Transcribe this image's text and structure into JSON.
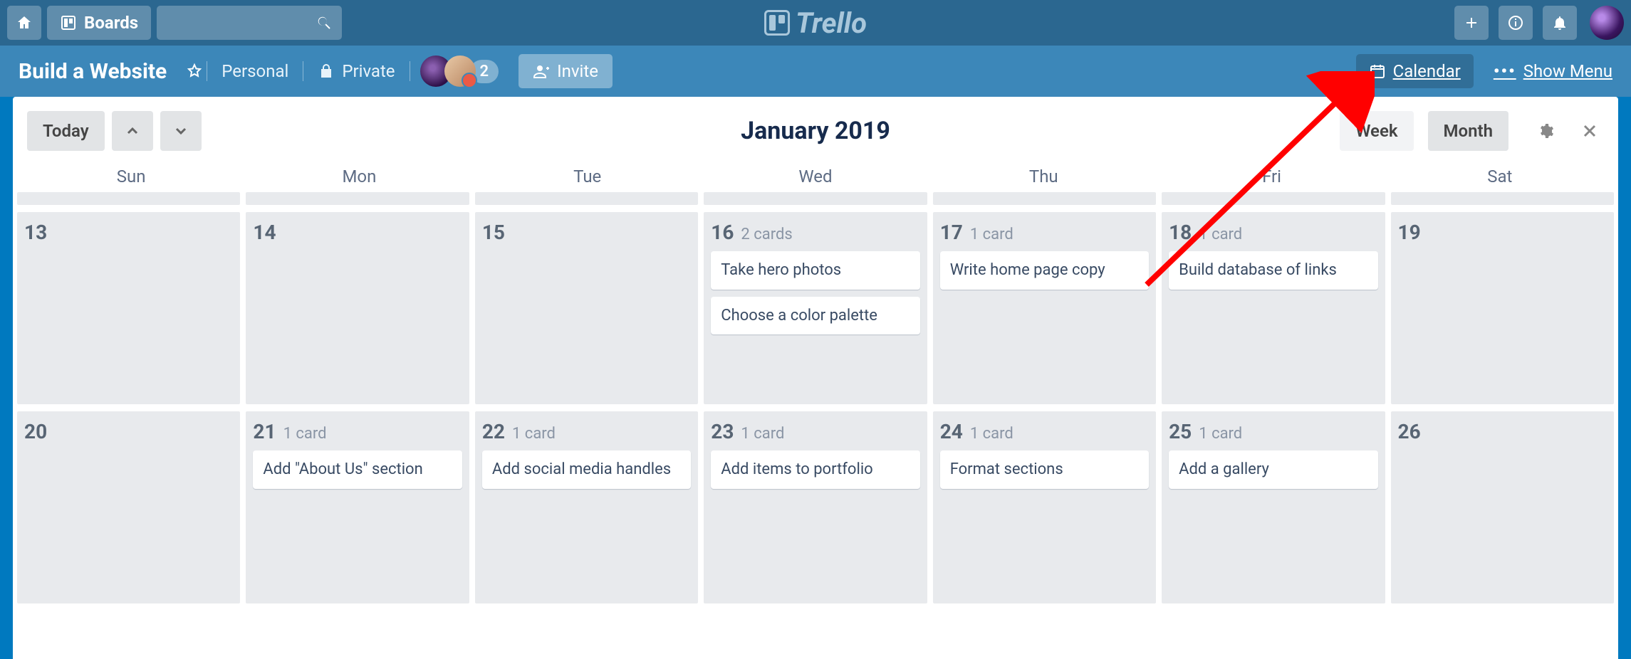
{
  "header": {
    "boards_label": "Boards",
    "logo_text": "Trello"
  },
  "board": {
    "title": "Build a Website",
    "visibility_team": "Personal",
    "visibility_level": "Private",
    "member_count": "2",
    "invite_label": "Invite",
    "calendar_label": "Calendar",
    "show_menu_label": "Show Menu"
  },
  "calendar": {
    "today_label": "Today",
    "title": "January 2019",
    "week_label": "Week",
    "month_label": "Month",
    "weekdays": [
      "Sun",
      "Mon",
      "Tue",
      "Wed",
      "Thu",
      "Fri",
      "Sat"
    ],
    "rows": [
      [
        {
          "day": "13",
          "count": "",
          "cards": []
        },
        {
          "day": "14",
          "count": "",
          "cards": []
        },
        {
          "day": "15",
          "count": "",
          "cards": []
        },
        {
          "day": "16",
          "count": "2 cards",
          "cards": [
            "Take hero photos",
            "Choose a color palette"
          ]
        },
        {
          "day": "17",
          "count": "1 card",
          "cards": [
            "Write home page copy"
          ]
        },
        {
          "day": "18",
          "count": "1 card",
          "cards": [
            "Build database of links"
          ]
        },
        {
          "day": "19",
          "count": "",
          "cards": []
        }
      ],
      [
        {
          "day": "20",
          "count": "",
          "cards": []
        },
        {
          "day": "21",
          "count": "1 card",
          "cards": [
            "Add \"About Us\" section"
          ]
        },
        {
          "day": "22",
          "count": "1 card",
          "cards": [
            "Add social media handles"
          ]
        },
        {
          "day": "23",
          "count": "1 card",
          "cards": [
            "Add items to portfolio"
          ]
        },
        {
          "day": "24",
          "count": "1 card",
          "cards": [
            "Format sections"
          ]
        },
        {
          "day": "25",
          "count": "1 card",
          "cards": [
            "Add a gallery"
          ]
        },
        {
          "day": "26",
          "count": "",
          "cards": []
        }
      ]
    ]
  }
}
